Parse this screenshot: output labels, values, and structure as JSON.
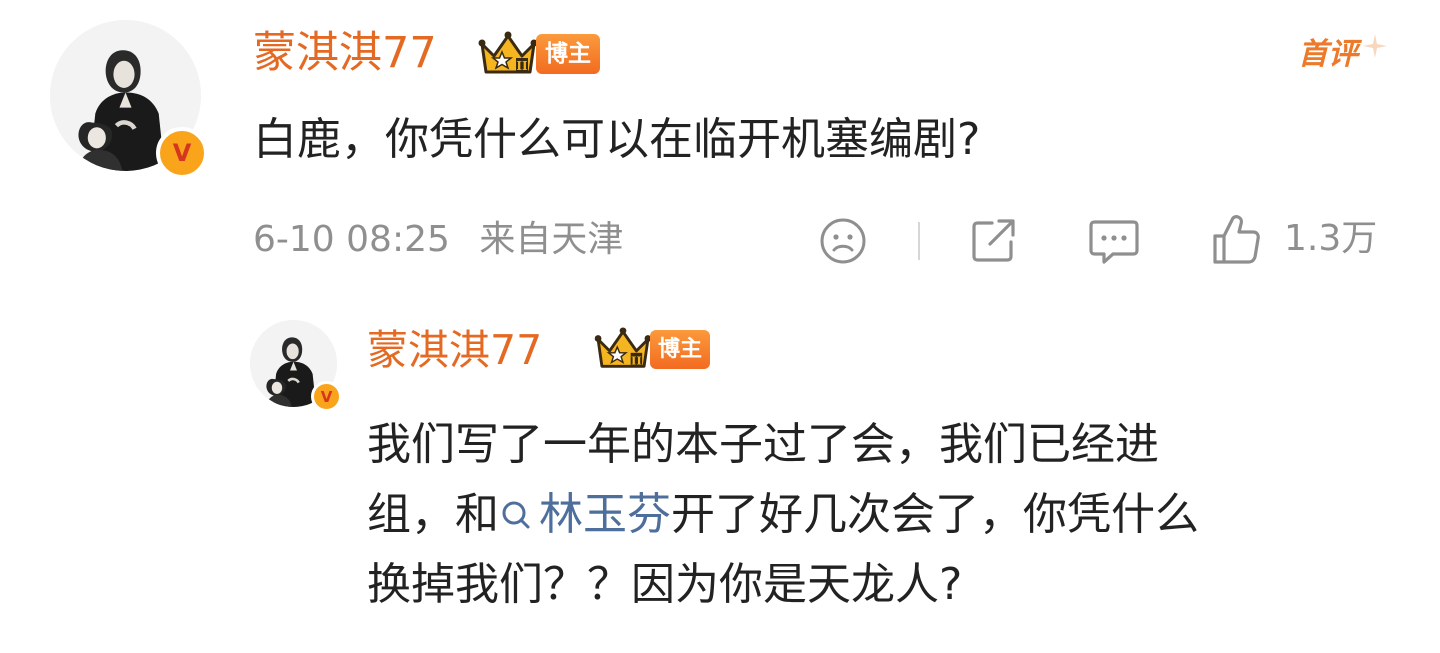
{
  "comment": {
    "author": "蒙淇淇77",
    "badge_label": "博主",
    "first_comment_label": "首评",
    "text": "白鹿，你凭什么可以在临开机塞编剧?",
    "time": "6-10 08:25",
    "location": "来自天津",
    "like_count": "1.3万"
  },
  "reply": {
    "author": "蒙淇淇77",
    "badge_label": "博主",
    "lines": [
      "我们写了一年的本子过了会，我们已经进",
      "开了好几次会了，你凭什么",
      "换掉我们？？因为你是天龙人?"
    ],
    "line2_prefix": "组，和",
    "topic_link": "林玉芬"
  },
  "icons": {
    "verified": "verified-v-icon",
    "crown": "crown-rank-icon",
    "dislike": "sad-face-icon",
    "share": "share-icon",
    "comment": "comment-bubble-icon",
    "like": "thumbs-up-icon",
    "search": "search-icon"
  },
  "colors": {
    "name": "#e46a24",
    "badge": "#f26b21",
    "link": "#4e6e9b",
    "meta": "#8f8f8f"
  }
}
